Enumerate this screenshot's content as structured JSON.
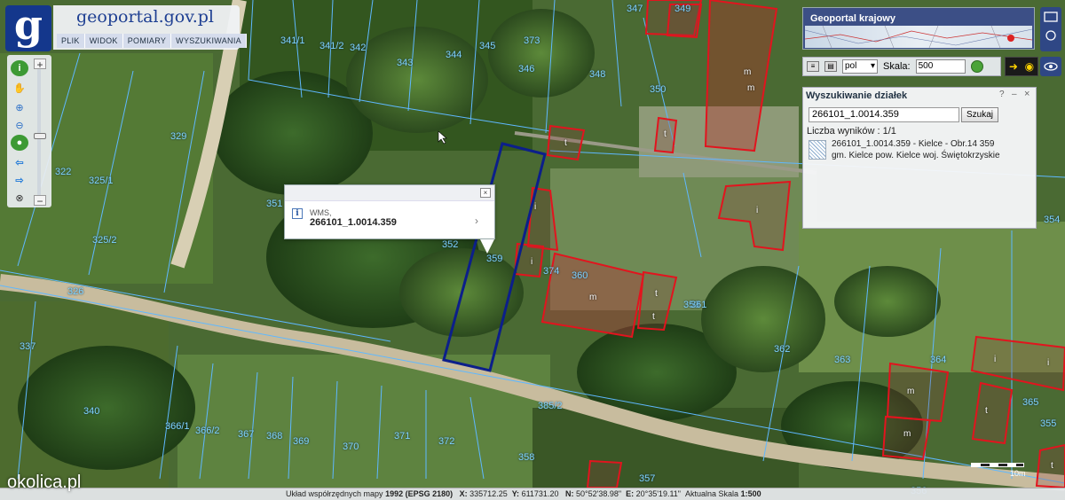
{
  "app": {
    "brand_title": "geoportal.gov.pl",
    "logo_letter": "g",
    "menu": [
      "PLIK",
      "WIDOK",
      "POMIARY",
      "WYSZUKIWANIA"
    ]
  },
  "national_panel": {
    "title": "Geoportal krajowy"
  },
  "toolbar": {
    "language": "pol",
    "scale_label": "Skala:",
    "scale_value": "500"
  },
  "search_panel": {
    "title": "Wyszukiwanie działek",
    "help": "?",
    "collapse": "–",
    "close": "×",
    "query": "266101_1.0014.359",
    "button": "Szukaj",
    "count": "Liczba wyników : 1/1",
    "result_line1": "266101_1.0014.359 - Kielce - Obr.14 359",
    "result_line2": "gm. Kielce pow. Kielce woj. Świętokrzyskie"
  },
  "popup": {
    "source": "WMS,",
    "parcel_id": "266101_1.0014.359",
    "close": "×",
    "arrow": "›"
  },
  "status": {
    "coord_system_label": "Układ współrzędnych mapy",
    "coord_system": "1992 (EPSG 2180)",
    "x_label": "X:",
    "x": "335712.25",
    "y_label": "Y:",
    "y": "611731.20",
    "n_label": "N:",
    "n": "50°52'38.98\"",
    "e_label": "E:",
    "e": "20°35'19.11\"",
    "scale_label": "Aktualna Skala",
    "scale": "1:500"
  },
  "watermark": "okolica.pl",
  "scalebar_label": "10m",
  "colors": {
    "parcel_line": "#5fb8ff",
    "building_line": "#e2141e",
    "selected_parcel": "#0c1f8a",
    "logo_bg": "#14378c"
  },
  "parcels": [
    "341/1",
    "341/2",
    "342",
    "343",
    "344",
    "345",
    "346",
    "347",
    "348",
    "349",
    "350",
    "322",
    "325/1",
    "325/2",
    "326",
    "329",
    "337",
    "340",
    "351",
    "352",
    "353",
    "354",
    "355",
    "356",
    "357",
    "358",
    "359",
    "360",
    "361",
    "362",
    "363",
    "364",
    "365",
    "366/1",
    "366/2",
    "367",
    "368",
    "369",
    "370",
    "371",
    "372",
    "373",
    "374",
    "385/2"
  ],
  "buildings": [
    "m",
    "m",
    "t",
    "t",
    "i",
    "i",
    "i",
    "t",
    "m",
    "t",
    "t",
    "i",
    "i",
    "m",
    "m",
    "t"
  ]
}
